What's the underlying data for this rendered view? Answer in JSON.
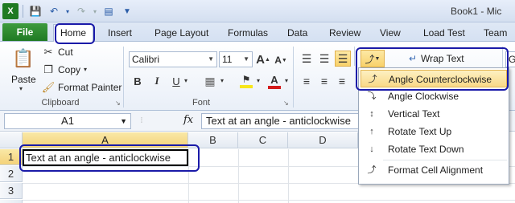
{
  "window": {
    "title": "Book1 - Mic"
  },
  "qat": {
    "icons": [
      "excel-icon",
      "save-icon",
      "undo-icon",
      "redo-icon",
      "customize-icon"
    ]
  },
  "tabs": [
    {
      "label": "File"
    },
    {
      "label": "Home"
    },
    {
      "label": "Insert"
    },
    {
      "label": "Page Layout"
    },
    {
      "label": "Formulas"
    },
    {
      "label": "Data"
    },
    {
      "label": "Review"
    },
    {
      "label": "View"
    },
    {
      "label": "Load Test"
    },
    {
      "label": "Team"
    }
  ],
  "ribbon": {
    "clipboard": {
      "paste": "Paste",
      "cut": "Cut",
      "copy": "Copy",
      "format_painter": "Format Painter",
      "group_label": "Clipboard"
    },
    "font": {
      "name": "Calibri",
      "size": "11",
      "group_label": "Font",
      "grow": "A",
      "shrink": "A",
      "bold": "B",
      "italic": "I",
      "underline": "U",
      "font_color_letter": "A"
    },
    "alignment": {
      "wrap_text": "Wrap Text",
      "right_edge": "G"
    },
    "colors": {
      "fill_color": "#f7e61a",
      "font_color": "#d31b1b",
      "accent": "#1f7a23",
      "annotation": "#1a1aa8"
    }
  },
  "formula_bar": {
    "name_box": "A1",
    "fx": "fx",
    "content": "Text at an angle - anticlockwise"
  },
  "grid": {
    "columns": [
      "A",
      "B",
      "C",
      "D"
    ],
    "rows": [
      "1",
      "2",
      "3"
    ],
    "cell_a1": "Text at an angle - anticlockwise"
  },
  "orientation_menu": {
    "items": [
      {
        "label": "Angle Counterclockwise",
        "icon": "angle-counterclockwise-icon"
      },
      {
        "label": "Angle Clockwise",
        "icon": "angle-clockwise-icon"
      },
      {
        "label": "Vertical Text",
        "icon": "vertical-text-icon"
      },
      {
        "label": "Rotate Text Up",
        "icon": "rotate-text-up-icon"
      },
      {
        "label": "Rotate Text Down",
        "icon": "rotate-text-down-icon"
      },
      {
        "label": "Format Cell Alignment",
        "icon": "format-cell-alignment-icon"
      }
    ]
  }
}
